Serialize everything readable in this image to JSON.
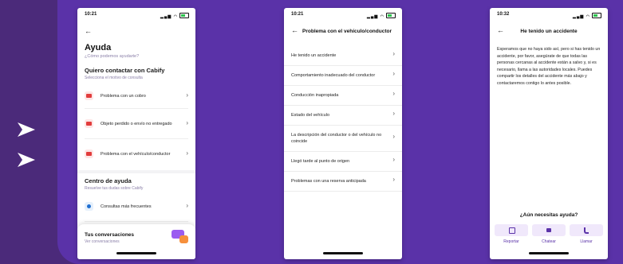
{
  "colors": {
    "background": "#4b2a7a",
    "panel": "#5a32a8",
    "accent": "#5a32a8",
    "white": "#ffffff"
  },
  "icons": [
    "play-arrow-icon",
    "back-arrow-icon",
    "chevron-right-icon",
    "receipt-icon",
    "box-icon",
    "car-icon",
    "question-icon",
    "chat-bubbles-icon",
    "report-icon",
    "chat-icon",
    "phone-icon"
  ],
  "screen1": {
    "time": "10:21",
    "title": "Ayuda",
    "subtitle": "¿Cómo podemos ayudarte?",
    "contact_title": "Quiero contactar con Cabify",
    "contact_sub": "Selecciona el motivo de consulta",
    "contact_items": [
      {
        "label": "Problema con un cobro",
        "icon": "receipt-icon"
      },
      {
        "label": "Objeto perdido o envío no entregado",
        "icon": "box-icon"
      },
      {
        "label": "Problema con el vehículo/conductor",
        "icon": "car-icon"
      }
    ],
    "help_title": "Centro de ayuda",
    "help_sub": "Resuelve tus dudas sobre Cabify",
    "help_items": [
      {
        "label": "Consultas más frecuentes",
        "icon": "question-icon"
      }
    ],
    "conversations_title": "Tus conversaciones",
    "conversations_sub": "Ver conversaciones"
  },
  "screen2": {
    "time": "10:21",
    "title": "Problema con el vehículo/conductor",
    "items": [
      "He tenido un accidente",
      "Comportamiento inadecuado del conductor",
      "Conducción inapropiada",
      "Estado del vehículo",
      "La descripción del conductor o del vehículo no coincide",
      "Llegó tarde al punto de origen",
      "Problemas con una reserva anticipada"
    ]
  },
  "screen3": {
    "time": "10:32",
    "title": "He tenido un accidente",
    "body": "Esperamos que no haya sido así, pero si has tenido un accidente, por favor, asegúrate de que todas las personas cercanas al accidente están a salvo y, si es necesario, llama a las autoridades locales. Puedes compartir los detalles del accidente más abajo y contactaremos contigo lo antes posible.",
    "question": "¿Aún necesitas ayuda?",
    "actions": [
      {
        "label": "Reportar",
        "icon": "report-icon"
      },
      {
        "label": "Chatear",
        "icon": "chat-icon"
      },
      {
        "label": "Llamar",
        "icon": "phone-icon"
      }
    ]
  }
}
